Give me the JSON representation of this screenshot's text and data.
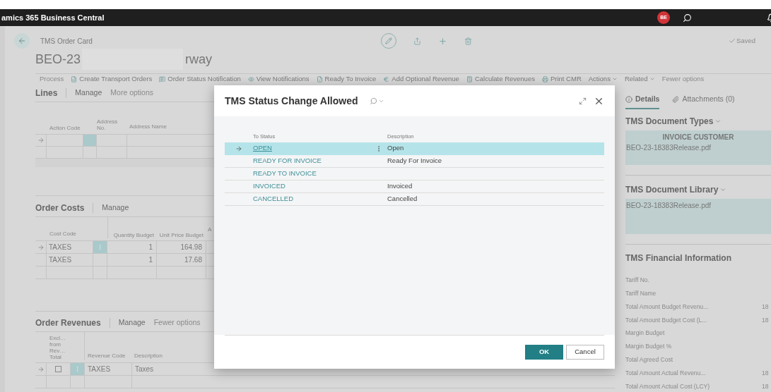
{
  "app_bar": {
    "title": "amics 365 Business Central",
    "avatar": "BE"
  },
  "page": {
    "caption": "TMS Order Card",
    "title_start": "BEO-23",
    "title_end": "rway",
    "saved": "Saved"
  },
  "actions": [
    {
      "label": "Process",
      "kind": "plain"
    },
    {
      "label": "Create Transport Orders",
      "kind": "icon"
    },
    {
      "label": "Order Status Notification",
      "kind": "icon"
    },
    {
      "label": "View Notifications",
      "kind": "icon"
    },
    {
      "label": "Ready To Invoice",
      "kind": "icon"
    },
    {
      "label": "Add Optional Revenue",
      "kind": "icon"
    },
    {
      "label": "Calculate Revenues",
      "kind": "icon"
    },
    {
      "label": "Print CMR",
      "kind": "icon"
    },
    {
      "label": "Actions",
      "kind": "menu"
    },
    {
      "label": "Related",
      "kind": "menu"
    },
    {
      "label": "Fewer options",
      "kind": "plain"
    }
  ],
  "lines": {
    "title": "Lines",
    "actions": [
      "Manage",
      "More options"
    ],
    "columns": [
      "Action Code",
      "Address No.",
      "Address Name"
    ],
    "rows": [
      {
        "selected": true
      },
      {
        "selected": false
      }
    ]
  },
  "order_costs": {
    "title": "Order Costs",
    "actions": [
      "Manage"
    ],
    "columns": [
      "Cost Code",
      "Quantity Budget",
      "Unit Price Budget",
      "A"
    ],
    "rows": [
      {
        "selected": true,
        "cells": [
          "TAXES",
          "1",
          "164.98"
        ]
      },
      {
        "selected": false,
        "cells": [
          "TAXES",
          "1",
          "17.68"
        ]
      }
    ]
  },
  "order_revenues": {
    "title": "Order Revenues",
    "actions": [
      "Manage",
      "Fewer options"
    ],
    "checkbox_column": "Excl… from Rev… Total",
    "columns": [
      "Revenue Code",
      "Description"
    ],
    "rows": [
      {
        "selected": true,
        "checked": false,
        "cells": [
          "TAXES",
          "Taxes"
        ]
      }
    ]
  },
  "factbox": {
    "tabs": [
      {
        "label": "Details",
        "selected": true
      },
      {
        "label": "Attachments (0)",
        "selected": false
      }
    ],
    "document_types": {
      "title": "TMS Document Types",
      "heading": "INVOICE CUSTOMER",
      "file": "BEO-23-18383Release.pdf"
    },
    "document_library": {
      "title": "TMS Document Library",
      "file": "BEO-23-18383Release.pdf"
    },
    "financial": {
      "title": "TMS Financial Information",
      "fields": [
        {
          "label": "Tariff No."
        },
        {
          "label": "Tariff Name"
        },
        {
          "label": "Total Amount Budget Revenu...",
          "value": "18"
        },
        {
          "label": "Total Amount Budget Cost (L...",
          "value": "18"
        },
        {
          "label": "Margin Budget"
        },
        {
          "label": "Margin Budget %"
        },
        {
          "label": "Total Agreed Cost"
        },
        {
          "label": "Total Amount Actual Revenu...",
          "value": "18"
        },
        {
          "label": "Total Amount Actual Cost (LCY)",
          "value": "18"
        }
      ]
    }
  },
  "dialog": {
    "title": "TMS Status Change Allowed",
    "columns": [
      "To Status",
      "Description"
    ],
    "rows": [
      {
        "status": "OPEN",
        "description": "Open",
        "selected": true
      },
      {
        "status": "READY FOR INVOICE",
        "description": "Ready For Invoice",
        "selected": false
      },
      {
        "status": "READY TO INVOICE",
        "selected": false
      },
      {
        "status": "INVOICED",
        "description": "Invoiced",
        "selected": false
      },
      {
        "status": "CANCELLED",
        "description": "Cancelled",
        "selected": false
      }
    ],
    "buttons": [
      "OK",
      "Cancel"
    ]
  }
}
